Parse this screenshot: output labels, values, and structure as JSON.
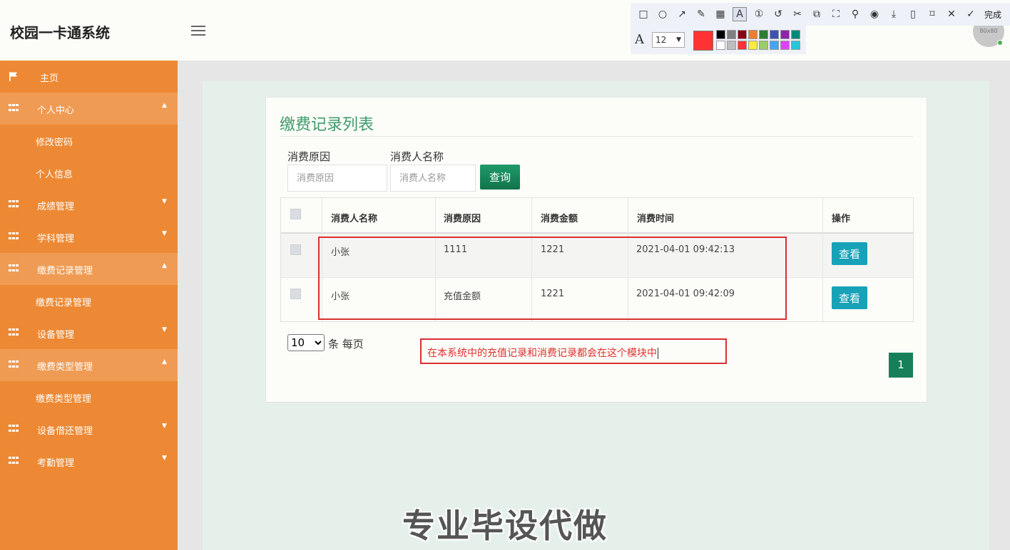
{
  "header": {
    "app_title": "校园一卡通系统",
    "avatar_text": "80x80"
  },
  "annotation_toolbar": {
    "tools": [
      "rect-icon",
      "ellipse-icon",
      "arrow-icon",
      "pencil-icon",
      "mosaic-icon",
      "text-icon",
      "number-icon",
      "undo-icon",
      "cut-icon",
      "translate-icon",
      "crop-icon",
      "pin-icon",
      "record-icon",
      "download-icon",
      "phone-icon",
      "bookmark-icon",
      "close-icon"
    ],
    "done_label": "完成",
    "font_size": "12",
    "current_color": "#ff3333",
    "palette": [
      "#000000",
      "#7f7f7f",
      "#880015",
      "#ed7d31",
      "#2e7d32",
      "#3f51b5",
      "#8e24aa",
      "#00897b",
      "#ffffff",
      "#bdbdbd",
      "#ff3333",
      "#ffeb3b",
      "#9ccc65",
      "#42a5f5",
      "#e040fb",
      "#26c6da"
    ]
  },
  "sidebar": {
    "items": [
      {
        "label": "主页",
        "type": "flag"
      },
      {
        "label": "个人中心",
        "type": "group",
        "open": true
      },
      {
        "label": "修改密码",
        "type": "sub"
      },
      {
        "label": "个人信息",
        "type": "sub"
      },
      {
        "label": "成绩管理",
        "type": "group",
        "open": false
      },
      {
        "label": "学科管理",
        "type": "group",
        "open": false
      },
      {
        "label": "缴费记录管理",
        "type": "group",
        "open": true
      },
      {
        "label": "缴费记录管理",
        "type": "sub"
      },
      {
        "label": "设备管理",
        "type": "group",
        "open": false
      },
      {
        "label": "缴费类型管理",
        "type": "group",
        "open": true
      },
      {
        "label": "缴费类型管理",
        "type": "sub"
      },
      {
        "label": "设备借还管理",
        "type": "group",
        "open": false
      },
      {
        "label": "考勤管理",
        "type": "group",
        "open": false
      }
    ]
  },
  "main": {
    "title": "缴费记录列表",
    "filters": {
      "reason_label": "消费原因",
      "reason_placeholder": "消费原因",
      "name_label": "消费人名称",
      "name_placeholder": "消费人名称",
      "search_label": "查询"
    },
    "table": {
      "headers": [
        "消费人名称",
        "消费原因",
        "消费金额",
        "消费时间",
        "操作"
      ],
      "rows": [
        {
          "name": "小张",
          "reason": "1111",
          "amount": "1221",
          "time": "2021-04-01 09:42:13",
          "action": "查看"
        },
        {
          "name": "小张",
          "reason": "充值金额",
          "amount": "1221",
          "time": "2021-04-01 09:42:09",
          "action": "查看"
        }
      ]
    },
    "pagination": {
      "page_size": "10",
      "page_size_options": [
        "10"
      ],
      "per_page_label": "条 每页",
      "current_page": "1"
    }
  },
  "annotation": {
    "text": "在本系统中的充值记录和消费记录都会在这个模块中",
    "color": "#e03030"
  },
  "watermark": "专业毕设代做"
}
